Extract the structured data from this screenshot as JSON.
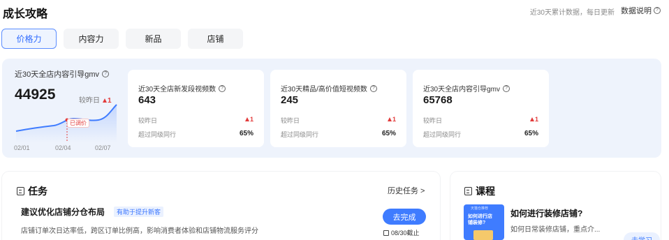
{
  "header": {
    "title": "成长攻略",
    "note": "近30天累计数据，每日更新",
    "help_label": "数据说明"
  },
  "tabs": [
    {
      "label": "价格力",
      "active": true
    },
    {
      "label": "内容力",
      "active": false
    },
    {
      "label": "新品",
      "active": false
    },
    {
      "label": "店铺",
      "active": false
    }
  ],
  "main_metric": {
    "title": "近30天全店内容引导gmv",
    "value": "44925",
    "compare_label": "较昨日",
    "change": "1",
    "chart_tag": "已调价",
    "x_labels": [
      "02/01",
      "02/04",
      "02/07"
    ]
  },
  "cards": [
    {
      "title": "近30天全店新发段视频数",
      "value": "643",
      "row1_label": "较昨日",
      "row1_value": "1",
      "row2_label": "超过同级同行",
      "row2_value": "65%"
    },
    {
      "title": "近30天精品/高价值短视频数",
      "value": "245",
      "row1_label": "较昨日",
      "row1_value": "1",
      "row2_label": "超过同级同行",
      "row2_value": "65%"
    },
    {
      "title": "近30天全店内容引导gmv",
      "value": "65768",
      "row1_label": "较昨日",
      "row1_value": "1",
      "row2_label": "超过同级同行",
      "row2_value": "65%"
    }
  ],
  "task": {
    "heading": "任务",
    "history_label": "历史任务 >",
    "title": "建议优化店铺分仓布局",
    "tag": "有助于提升新客",
    "description": "店铺订单次日达率低，跨区订单比例高，影响消费者体验和店铺物流服务评分",
    "button": "去完成",
    "deadline": "08/30截止"
  },
  "course": {
    "heading": "课程",
    "thumb_badge": "天猫仓推荐",
    "thumb_text": "如何进行店铺装修?",
    "title": "如何进行装修店铺?",
    "description": "如何日常装修店铺，重点介...",
    "button": "去学习"
  },
  "colors": {
    "accent": "#3f7cff",
    "up": "#e23b3b",
    "metrics_bg": "#eef3fc"
  }
}
